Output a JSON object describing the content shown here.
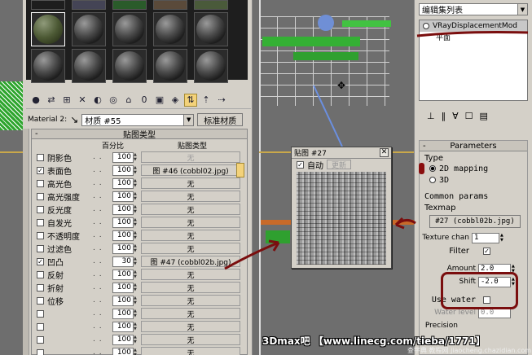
{
  "material_editor": {
    "material_label": "Material 2:",
    "material_name": "材质 #55",
    "standard_material_btn": "标准材质",
    "maps_rollout_title": "贴图类型",
    "col_amount": "百分比",
    "col_map_type": "贴图类型",
    "map_rows": [
      {
        "label": "阴影色",
        "checked": false,
        "amount": "100",
        "map": "无",
        "disabled": true
      },
      {
        "label": "表面色",
        "checked": true,
        "amount": "100",
        "map": "图 #46 (cobbl02.jpg)",
        "disabled": false
      },
      {
        "label": "高光色",
        "checked": false,
        "amount": "100",
        "map": "无",
        "disabled": false
      },
      {
        "label": "高光强度",
        "checked": false,
        "amount": "100",
        "map": "无",
        "disabled": false
      },
      {
        "label": "反光度",
        "checked": false,
        "amount": "100",
        "map": "无",
        "disabled": false
      },
      {
        "label": "自发光",
        "checked": false,
        "amount": "100",
        "map": "无",
        "disabled": false
      },
      {
        "label": "不透明度",
        "checked": false,
        "amount": "100",
        "map": "无",
        "disabled": false
      },
      {
        "label": "过滤色",
        "checked": false,
        "amount": "100",
        "map": "无",
        "disabled": false
      },
      {
        "label": "凹凸",
        "checked": true,
        "amount": "30",
        "map": "图 #47 (cobbl02b.jpg)",
        "disabled": false
      },
      {
        "label": "反射",
        "checked": false,
        "amount": "100",
        "map": "无",
        "disabled": false
      },
      {
        "label": "折射",
        "checked": false,
        "amount": "100",
        "map": "无",
        "disabled": false
      },
      {
        "label": "位移",
        "checked": false,
        "amount": "100",
        "map": "无",
        "disabled": false
      },
      {
        "label": "",
        "checked": false,
        "amount": "100",
        "map": "无",
        "disabled": false
      },
      {
        "label": "",
        "checked": false,
        "amount": "100",
        "map": "无",
        "disabled": false
      },
      {
        "label": "",
        "checked": false,
        "amount": "100",
        "map": "无",
        "disabled": false
      },
      {
        "label": "",
        "checked": false,
        "amount": "100",
        "map": "无",
        "disabled": false
      }
    ]
  },
  "texture_window": {
    "title": "贴图 #27",
    "auto_label": "自动",
    "update_label": "更新"
  },
  "command_panel": {
    "modifier_list": "编辑集列表",
    "stack_item_1": "VRayDisplacementMod",
    "stack_item_2": "平面",
    "params_title": "Parameters",
    "type_label": "Type",
    "type_2d": "2D mapping",
    "type_3d": "3D",
    "common_params": "Common params",
    "texmap_label": "Texmap",
    "texmap_value": "#27 (cobbl02b.jpg)",
    "texture_chan_label": "Texture chan",
    "texture_chan_value": "1",
    "filter_label": "Filter",
    "amount_label": "Amount",
    "amount_value": "2.0",
    "shift_label": "Shift",
    "shift_value": "-2.0",
    "use_water_label": "Use water",
    "water_level_label": "Water level",
    "water_level_value": "0.0",
    "precision_label": "Precision"
  },
  "watermark": "3Dmax吧 【www.linecg.com/tieba/1771】",
  "watermark_sub": "查字典 教程网 jiaocheng.chazidian.com",
  "colors": {
    "annotation_red": "#7a0e0e",
    "panel_gray": "#d4d0c8",
    "active_yellow": "#f3d27a"
  }
}
